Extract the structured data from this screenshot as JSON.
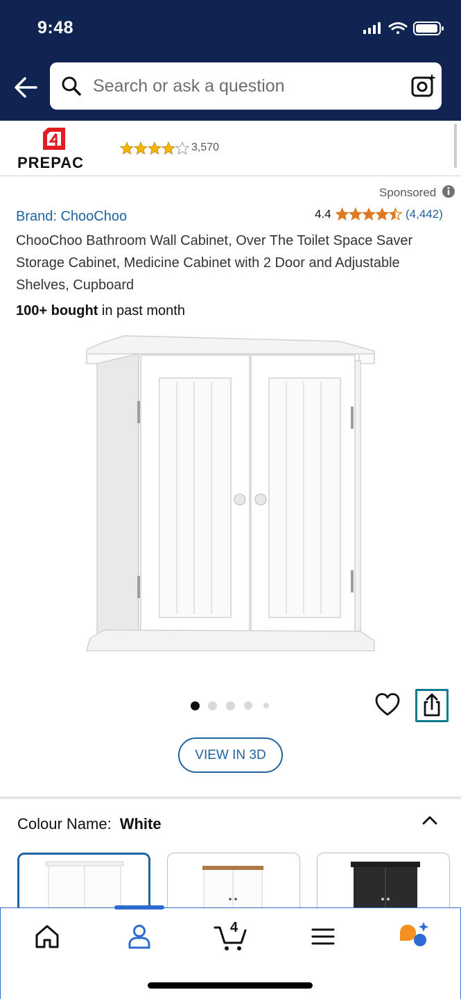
{
  "status_bar": {
    "time": "9:48"
  },
  "search": {
    "placeholder": "Search or ask a question"
  },
  "ad_banner": {
    "brand": "PREPAC",
    "rating_count": "3,570"
  },
  "product": {
    "sponsored_label": "Sponsored",
    "brand": "Brand: ChooChoo",
    "rating": "4.4",
    "rating_count": "(4,442)",
    "title": "ChooChoo Bathroom Wall Cabinet, Over The Toilet Space Saver Storage Cabinet, Medicine Cabinet with 2 Door and Adjustable Shelves, Cupboard",
    "bought_bold": "100+ bought",
    "bought_rest": " in past month",
    "image_count": 5,
    "active_image": 1,
    "view_3d_label": "VIEW IN 3D"
  },
  "variation": {
    "label": "Colour Name:",
    "value": "White",
    "swatches": [
      "White",
      "White with wood top",
      "Black"
    ]
  },
  "bottom_nav": {
    "items": [
      "home-icon",
      "account-icon",
      "cart-icon",
      "menu-icon",
      "rufus-icon"
    ],
    "cart_count": "4",
    "selected": "account-icon"
  },
  "colors": {
    "header_bg": "#0f2451",
    "link": "#2162a1",
    "star": "#de7921",
    "accent": "#2c6bd1"
  }
}
